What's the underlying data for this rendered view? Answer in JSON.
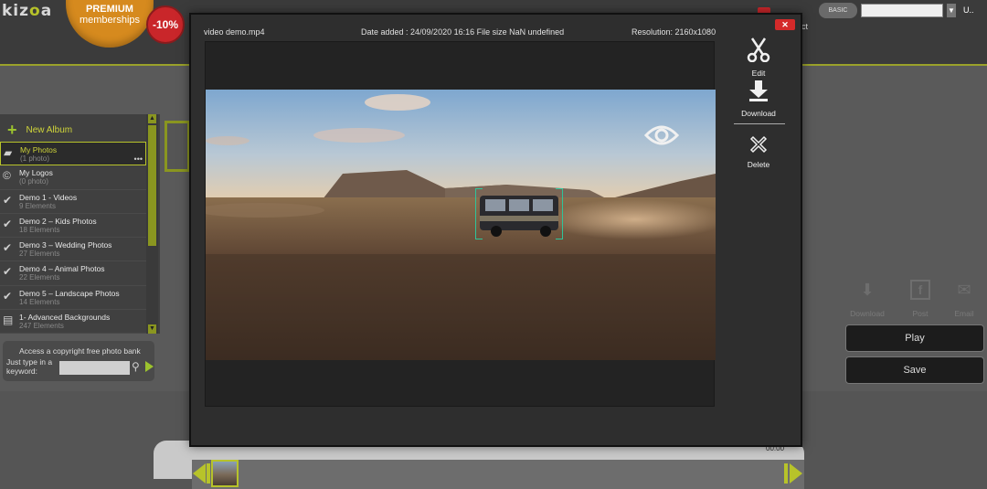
{
  "app": {
    "logo_text_a": "kiz",
    "logo_text_o": "o",
    "logo_text_b": "a"
  },
  "promo": {
    "line1": "PREMIUM",
    "line2": "memberships",
    "discount": "-10%"
  },
  "topright": {
    "plan_label": "BASIC",
    "user_short": "U..",
    "act_text": "act"
  },
  "sidebar": {
    "new_album_label": "New Album",
    "albums": [
      {
        "name": "My Photos",
        "count": "(1 photo)",
        "active": true
      },
      {
        "name": "My Logos",
        "count": "(0 photo)",
        "active": false
      },
      {
        "name": "Demo 1 - Videos",
        "count": "9 Elements",
        "active": false
      },
      {
        "name": "Demo 2 – Kids Photos",
        "count": "18 Elements",
        "active": false
      },
      {
        "name": "Demo 3 – Wedding Photos",
        "count": "27 Elements",
        "active": false
      },
      {
        "name": "Demo 4 – Animal Photos",
        "count": "22 Elements",
        "active": false
      },
      {
        "name": "Demo 5 – Landscape Photos",
        "count": "14 Elements",
        "active": false
      },
      {
        "name": "1- Advanced Backgrounds",
        "count": "247 Elements",
        "active": false
      }
    ]
  },
  "photo_bank": {
    "heading": "Access a copyright free photo bank",
    "prompt": "Just type in a keyword:",
    "placeholder": ""
  },
  "share": {
    "download": "Download",
    "post": "Post",
    "email": "Email"
  },
  "actions": {
    "play": "Play",
    "save": "Save"
  },
  "timeline": {
    "time_label": "00:00"
  },
  "modal": {
    "filename": "video demo.mp4",
    "date_info": "Date added : 24/09/2020 16:16 File size NaN undefined",
    "resolution": "Resolution: 2160x1080",
    "close_label": "✕",
    "tools": {
      "edit": "Edit",
      "download": "Download",
      "delete": "Delete"
    }
  },
  "colors": {
    "accent": "#b7c32a",
    "close_red": "#d42a2a",
    "focus_green": "#2fc49a"
  }
}
